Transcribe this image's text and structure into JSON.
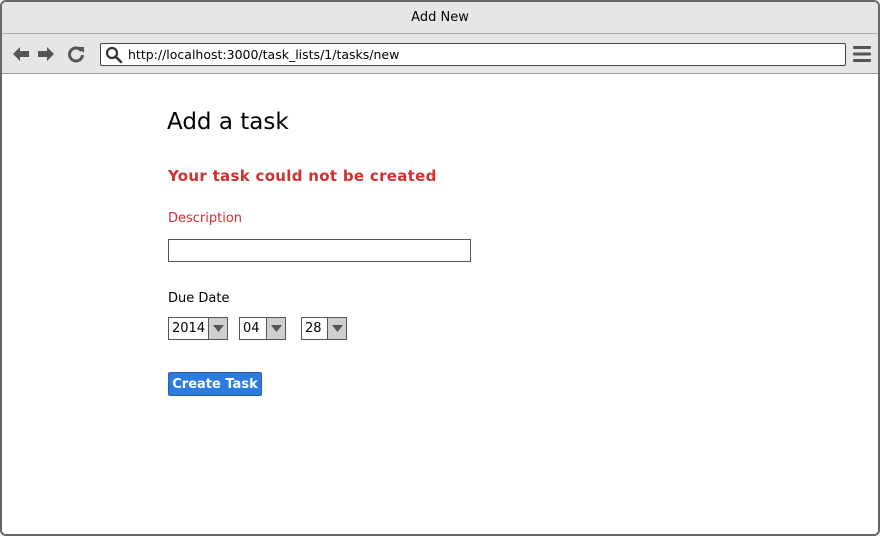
{
  "window": {
    "title": "Add New"
  },
  "browser": {
    "url": "http://localhost:3000/task_lists/1/tasks/new",
    "icons": [
      "back-arrow-icon",
      "forward-arrow-icon",
      "reload-icon",
      "search-icon",
      "hamburger-menu-icon"
    ]
  },
  "form": {
    "heading": "Add a task",
    "error_message": "Your task could not be created",
    "description_label": "Description",
    "description_value": "",
    "due_date_label": "Due Date",
    "due_year": "2014",
    "due_month": "04",
    "due_day": "28",
    "submit_label": "Create Task"
  },
  "colors": {
    "error": "#d22f2f",
    "button": "#2b7be0",
    "chrome": "#e6e6e6"
  }
}
